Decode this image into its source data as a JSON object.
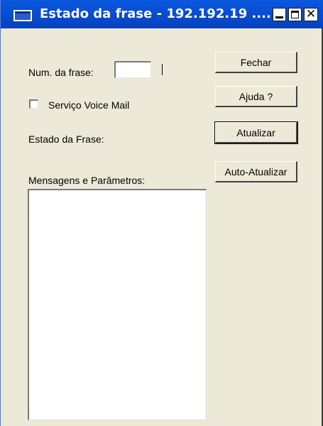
{
  "window": {
    "title": "Estado da frase - 192.192.19 ....",
    "controls": {
      "close_glyph": "✕"
    }
  },
  "form": {
    "num_label": "Num. da frase:",
    "num_value": "",
    "checkbox_label": "Serviço Voice Mail",
    "checkbox_checked": false,
    "status_label": "Estado da Frase:",
    "messages_label": "Mensagens e Parâmetros:",
    "messages_text": ""
  },
  "buttons": {
    "fechar": "Fechar",
    "ajuda": "Ajuda ?",
    "atualizar": "Atualizar",
    "auto_atualizar": "Auto-Atualizar"
  },
  "icons": [
    "window-app-icon",
    "minimize-icon",
    "maximize-icon",
    "close-icon",
    "checkbox-icon"
  ],
  "colors": {
    "titlebar": "#0a58de",
    "face": "#ece9d8",
    "field": "#ffffff"
  }
}
